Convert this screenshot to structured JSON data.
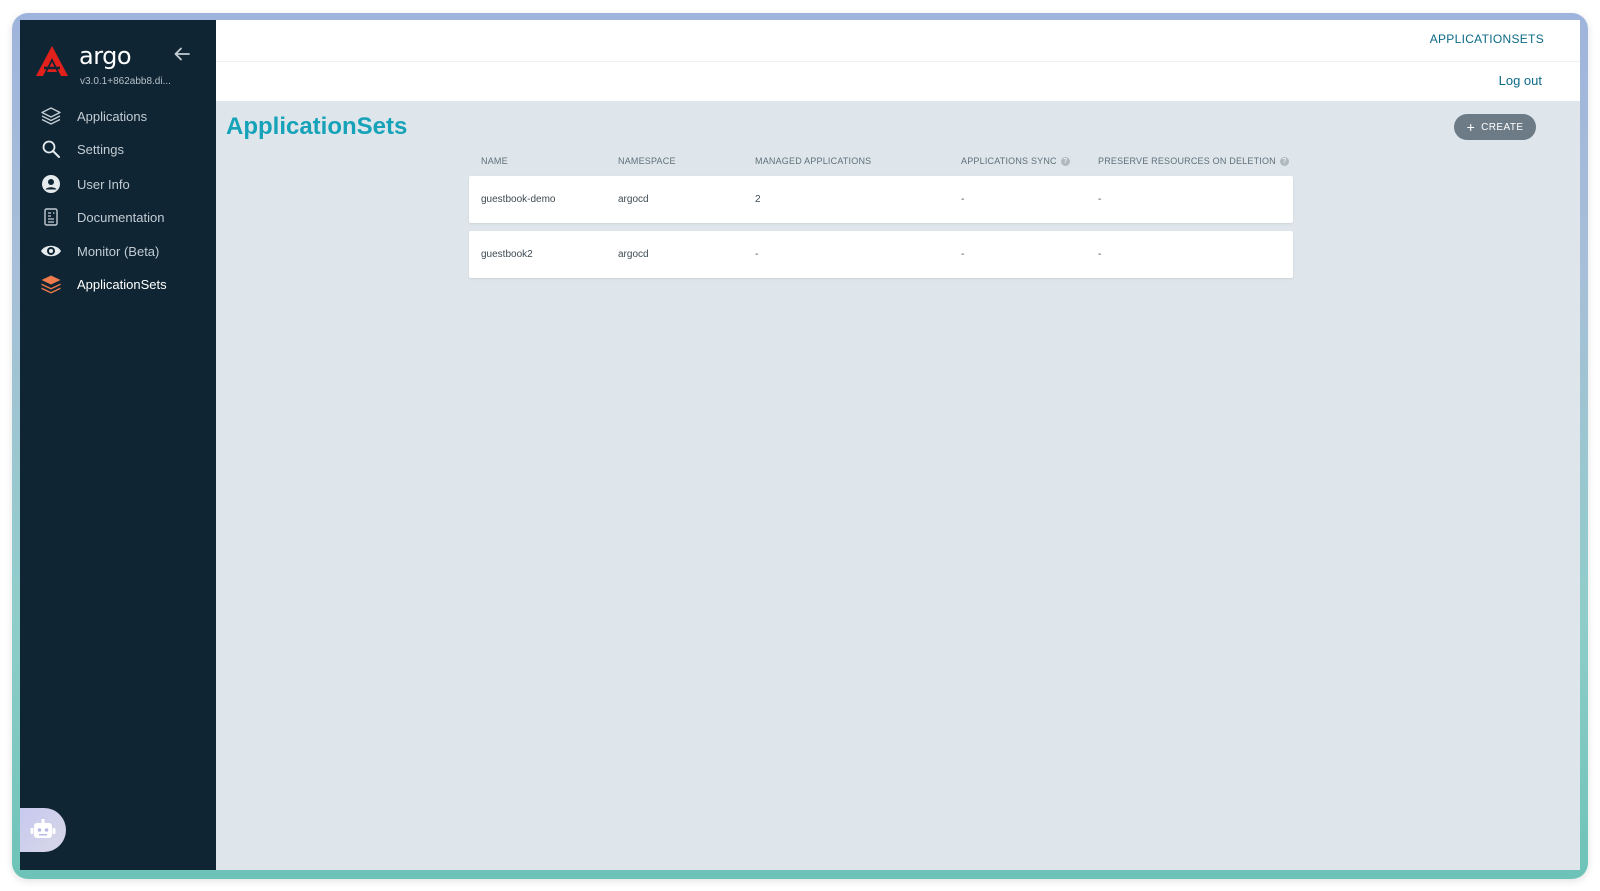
{
  "brand": {
    "name": "argo",
    "version": "v3.0.1+862abb8.di..."
  },
  "sidebar": {
    "items": [
      {
        "label": "Applications",
        "icon": "layers-icon"
      },
      {
        "label": "Settings",
        "icon": "search-icon"
      },
      {
        "label": "User Info",
        "icon": "user-circle-icon"
      },
      {
        "label": "Documentation",
        "icon": "document-icon"
      },
      {
        "label": "Monitor (Beta)",
        "icon": "eye-icon"
      },
      {
        "label": "ApplicationSets",
        "icon": "stack-icon",
        "active": true
      }
    ]
  },
  "topbar": {
    "breadcrumb": "APPLICATIONSETS",
    "logout": "Log out"
  },
  "page": {
    "title": "ApplicationSets",
    "create_label": "CREATE"
  },
  "table": {
    "headers": [
      "NAME",
      "NAMESPACE",
      "MANAGED APPLICATIONS",
      "APPLICATIONS SYNC",
      "PRESERVE RESOURCES ON DELETION"
    ],
    "help_glyph": "?",
    "rows": [
      [
        "guestbook-demo",
        "argocd",
        "2",
        "-",
        "-"
      ],
      [
        "guestbook2",
        "argocd",
        "-",
        "-",
        "-"
      ]
    ]
  },
  "colors": {
    "sidebar_bg": "#0f2533",
    "accent_title": "#16a2b8",
    "link": "#0c6a88",
    "brand_red": "#e2211c",
    "active_icon": "#ef7b4d",
    "content_bg": "#dee6eb"
  }
}
